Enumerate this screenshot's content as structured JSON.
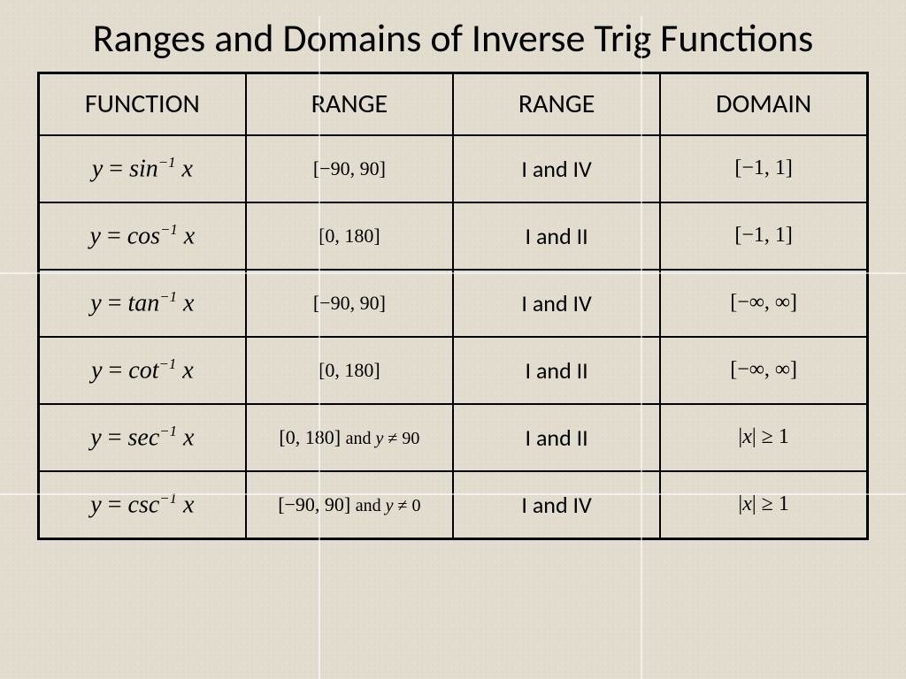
{
  "title": "Ranges and Domains of Inverse Trig Functions",
  "headers": [
    "FUNCTION",
    "RANGE",
    "RANGE",
    "DOMAIN"
  ],
  "rows": [
    {
      "func_html": "<span class='var'>y</span> <span class='op'>=</span> sin<sup>&minus;1</sup> <span class='var'>x</span>",
      "range_num_html": "[&minus;90, 90]",
      "range_q": "I and IV",
      "domain_html": "[&minus;1, 1]"
    },
    {
      "func_html": "<span class='var'>y</span> <span class='op'>=</span> cos<sup>&minus;1</sup> <span class='var'>x</span>",
      "range_num_html": "[0, 180]",
      "range_q": "I and II",
      "domain_html": "[&minus;1, 1]"
    },
    {
      "func_html": "<span class='var'>y</span> <span class='op'>=</span> tan<sup>&minus;1</sup> <span class='var'>x</span>",
      "range_num_html": "[&minus;90, 90]",
      "range_q": "I and IV",
      "domain_html": "[&minus;&infin;, &infin;]"
    },
    {
      "func_html": "<span class='var'>y</span> <span class='op'>=</span> cot<sup>&minus;1</sup> <span class='var'>x</span>",
      "range_num_html": "[0, 180]",
      "range_q": "I and II",
      "domain_html": "[&minus;&infin;, &infin;]"
    },
    {
      "func_html": "<span class='var'>y</span> <span class='op'>=</span> sec<sup>&minus;1</sup> <span class='var'>x</span>",
      "range_num_html": "[0, 180] <span class='extra'>and <i>y</i> &ne; 90</span>",
      "range_q": "I and II",
      "domain_html": "|<i>x</i>| &ge; 1"
    },
    {
      "func_html": "<span class='var'>y</span> <span class='op'>=</span> csc<sup>&minus;1</sup> <span class='var'>x</span>",
      "range_num_html": "[&minus;90, 90] <span class='extra'>and <i>y</i> &ne; 0</span>",
      "range_q": "I and IV",
      "domain_html": "|<i>x</i>| &ge; 1"
    }
  ]
}
